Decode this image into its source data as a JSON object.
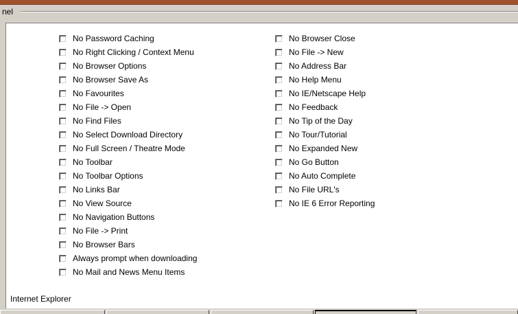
{
  "panel": {
    "title": "nel"
  },
  "options_left": [
    {
      "label": "No Password Caching",
      "checked": false
    },
    {
      "label": "No Right Clicking / Context Menu",
      "checked": false
    },
    {
      "label": "No Browser Options",
      "checked": false
    },
    {
      "label": "No Browser Save As",
      "checked": false
    },
    {
      "label": "No Favourites",
      "checked": false
    },
    {
      "label": "No File -> Open",
      "checked": false
    },
    {
      "label": "No Find Files",
      "checked": false
    },
    {
      "label": "No Select Download Directory",
      "checked": false
    },
    {
      "label": "No Full Screen / Theatre Mode",
      "checked": false
    },
    {
      "label": "No Toolbar",
      "checked": false
    },
    {
      "label": "No Toolbar Options",
      "checked": false
    },
    {
      "label": "No Links Bar",
      "checked": false
    },
    {
      "label": "No View Source",
      "checked": false
    },
    {
      "label": "No Navigation Buttons",
      "checked": false
    },
    {
      "label": "No File -> Print",
      "checked": false
    },
    {
      "label": "No Browser Bars",
      "checked": false
    },
    {
      "label": "Always prompt when downloading",
      "checked": false
    },
    {
      "label": "No Mail and News Menu Items",
      "checked": false
    }
  ],
  "options_right": [
    {
      "label": "No Browser Close",
      "checked": false
    },
    {
      "label": "No File -> New",
      "checked": false
    },
    {
      "label": "No Address Bar",
      "checked": false
    },
    {
      "label": "No Help Menu",
      "checked": false
    },
    {
      "label": "No IE/Netscape Help",
      "checked": false
    },
    {
      "label": "No Feedback",
      "checked": false
    },
    {
      "label": "No Tip of the Day",
      "checked": false
    },
    {
      "label": "No Tour/Tutorial",
      "checked": false
    },
    {
      "label": "No Expanded New",
      "checked": false
    },
    {
      "label": "No Go Button",
      "checked": false
    },
    {
      "label": "No Auto Complete",
      "checked": false
    },
    {
      "label": "No File URL's",
      "checked": false
    },
    {
      "label": "No IE 6 Error Reporting",
      "checked": false
    }
  ],
  "footer": {
    "label": "Internet Explorer"
  },
  "colors": {
    "top_strip": "#a0522d",
    "dialog_bg": "#d4d0c8",
    "content_bg": "#ffffff"
  }
}
